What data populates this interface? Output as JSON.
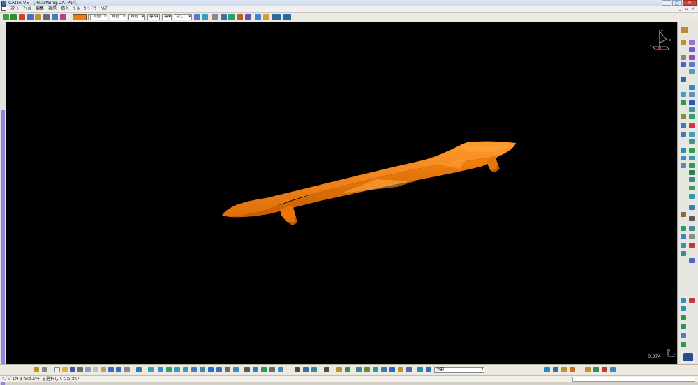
{
  "window": {
    "title": "CATIA V5 - [RearWing.CATPart]",
    "buttons": {
      "minimize": "–",
      "maximize": "□",
      "close": "✕"
    }
  },
  "menubar": {
    "items": [
      "ｽﾀｰﾄ",
      "ﾌｧｲﾙ",
      "編集",
      "表示",
      "挿入",
      "ﾂｰﾙ",
      "ｳｨﾝﾄﾞｳ",
      "ﾍﾙﾌﾟ"
    ],
    "doc_controls": [
      "_",
      "▫",
      "×"
    ]
  },
  "properties_toolbar": {
    "color": "#f07f10",
    "dropdowns": [
      {
        "value": "自動"
      },
      {
        "value": "自動"
      },
      {
        "value": "自動"
      },
      {
        "value": "標準"
      },
      {
        "value": "標準"
      },
      {
        "value": "なし"
      }
    ]
  },
  "viewport": {
    "background": "#000000",
    "part_color": "#f07f10",
    "compass_labels": {
      "z": "z",
      "x": "x",
      "y": "y"
    },
    "scale_readout": "0.374",
    "mini_axis_labels": {
      "y": "y",
      "x": "x"
    }
  },
  "bottom_toolbar": {
    "dropdown_value": "分割"
  },
  "statusbar": {
    "text": "ｵﾌﾞｼﾞｪｸﾄまたはｺﾏﾝﾄﾞを選択してください"
  }
}
